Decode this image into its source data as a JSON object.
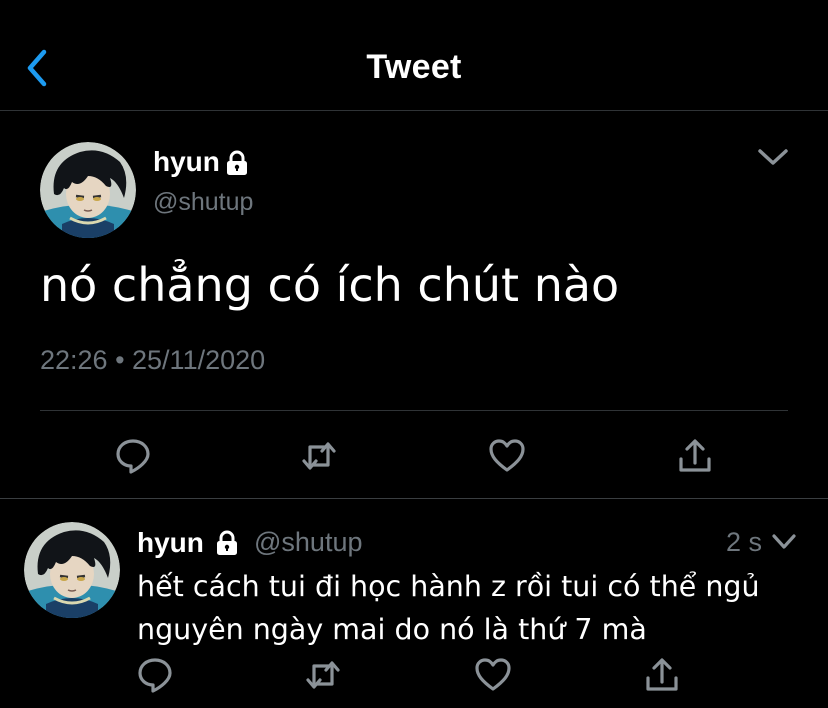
{
  "header": {
    "title": "Tweet",
    "back_icon": "chevron-left-icon"
  },
  "colors": {
    "accent": "#1d9bf0",
    "background": "#000000",
    "secondary_text": "#6e767d",
    "divider": "#2f3336"
  },
  "main_tweet": {
    "display_name": "hyun",
    "handle": "@shutup",
    "protected_icon": "lock-icon",
    "menu_icon": "chevron-down-icon",
    "text": "nó chẳng có ích chút nào",
    "timestamp": "22:26 • 25/11/2020",
    "actions": [
      "reply-icon",
      "retweet-icon",
      "like-icon",
      "share-icon"
    ]
  },
  "reply_tweet": {
    "display_name": "hyun",
    "handle": "@shutup",
    "protected_icon": "lock-icon",
    "age": "2 s",
    "menu_icon": "chevron-down-icon",
    "text": "hết cách tui đi học hành z rồi tui có thể ngủ nguyên ngày mai do nó là thứ 7 mà",
    "actions": [
      "reply-icon",
      "retweet-icon",
      "like-icon",
      "share-icon"
    ]
  }
}
